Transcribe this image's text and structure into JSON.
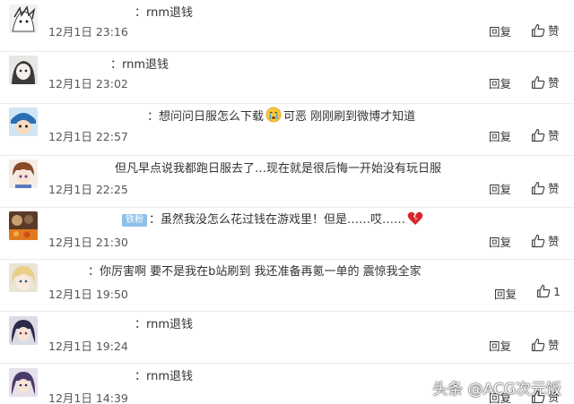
{
  "comments": [
    {
      "text": "：rnm退钱",
      "date": "12月1日 23:16",
      "reply": "回复",
      "like": "赞"
    },
    {
      "text": "：rnm退钱",
      "date": "12月1日 23:02",
      "reply": "回复",
      "like": "赞"
    },
    {
      "text_before": "：想问问日服怎么下载",
      "text_after": "可恶 刚刚刷到微博才知道",
      "date": "12月1日 22:57",
      "reply": "回复",
      "like": "赞"
    },
    {
      "text": "但凡早点说我都跑日服去了…现在就是很后悔一开始没有玩日服",
      "date": "12月1日 22:25",
      "reply": "回复",
      "like": "赞"
    },
    {
      "badge": "铁粉",
      "text": "：虽然我没怎么花过钱在游戏里！但是……哎……",
      "date": "12月1日 21:30",
      "reply": "回复",
      "like": "赞"
    },
    {
      "text": "：你厉害啊 要不是我在b站刷到 我还准备再氪一单的 震惊我全家",
      "date": "12月1日 19:50",
      "reply": "回复",
      "like": "1"
    },
    {
      "text": "：rnm退钱",
      "date": "12月1日 19:24",
      "reply": "回复",
      "like": "赞"
    },
    {
      "text": "：rnm退钱",
      "date": "12月1日 14:39",
      "reply": "回复",
      "like": "赞"
    }
  ],
  "watermark": "头条 @ACG次元饭"
}
